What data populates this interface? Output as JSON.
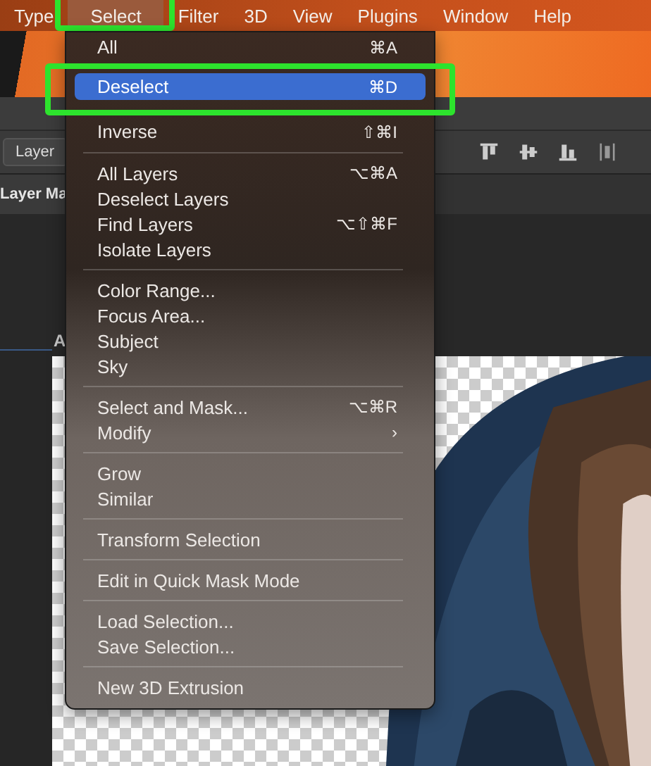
{
  "menu_bar": {
    "items": [
      {
        "label": "Type",
        "selected": false,
        "annotated": false
      },
      {
        "label": "Select",
        "selected": true,
        "annotated": true
      },
      {
        "label": "Filter",
        "selected": false,
        "annotated": false
      },
      {
        "label": "3D",
        "selected": false,
        "annotated": false
      },
      {
        "label": "View",
        "selected": false,
        "annotated": false
      },
      {
        "label": "Plugins",
        "selected": false,
        "annotated": false
      },
      {
        "label": "Window",
        "selected": false,
        "annotated": false
      },
      {
        "label": "Help",
        "selected": false,
        "annotated": false
      }
    ]
  },
  "options_bar": {
    "dropdown": "Layer"
  },
  "document_tab": {
    "label": "Layer Ma"
  },
  "canvas_label": "A",
  "menu": {
    "sections": [
      [
        {
          "label": "All",
          "shortcut": "⌘A",
          "selected": false,
          "disabled": false,
          "annotated": false
        },
        {
          "label": "Deselect",
          "shortcut": "⌘D",
          "selected": true,
          "disabled": false,
          "annotated": true
        },
        {
          "label": "Inverse",
          "shortcut": "⇧⌘I",
          "selected": false,
          "disabled": false,
          "annotated": false
        }
      ],
      [
        {
          "label": "All Layers",
          "shortcut": "⌥⌘A",
          "selected": false,
          "disabled": false,
          "annotated": false
        },
        {
          "label": "Deselect Layers",
          "selected": false,
          "disabled": false,
          "annotated": false
        },
        {
          "label": "Find Layers",
          "shortcut": "⌥⇧⌘F",
          "selected": false,
          "disabled": false,
          "annotated": false
        },
        {
          "label": "Isolate Layers",
          "selected": false,
          "disabled": false,
          "annotated": false
        }
      ],
      [
        {
          "label": "Color Range...",
          "selected": false,
          "disabled": false,
          "annotated": false
        },
        {
          "label": "Focus Area...",
          "selected": false,
          "disabled": false,
          "annotated": false
        },
        {
          "label": "Subject",
          "selected": false,
          "disabled": false,
          "annotated": false
        },
        {
          "label": "Sky",
          "selected": false,
          "disabled": false,
          "annotated": false
        }
      ],
      [
        {
          "label": "Select and Mask...",
          "shortcut": "⌥⌘R",
          "selected": false,
          "disabled": false,
          "annotated": false
        },
        {
          "label": "Modify",
          "submenu": "›",
          "selected": false,
          "disabled": false,
          "annotated": false
        }
      ],
      [
        {
          "label": "Grow",
          "selected": false,
          "disabled": false,
          "annotated": false
        },
        {
          "label": "Similar",
          "selected": false,
          "disabled": false,
          "annotated": false
        }
      ],
      [
        {
          "label": "Transform Selection",
          "selected": false,
          "disabled": false,
          "annotated": false
        }
      ],
      [
        {
          "label": "Edit in Quick Mask Mode",
          "selected": false,
          "disabled": false,
          "annotated": false
        }
      ],
      [
        {
          "label": "Load Selection...",
          "selected": false,
          "disabled": false,
          "annotated": false
        },
        {
          "label": "Save Selection...",
          "selected": false,
          "disabled": false,
          "annotated": false
        }
      ],
      [
        {
          "label": "New 3D Extrusion",
          "selected": false,
          "disabled": false,
          "annotated": false
        }
      ]
    ]
  }
}
